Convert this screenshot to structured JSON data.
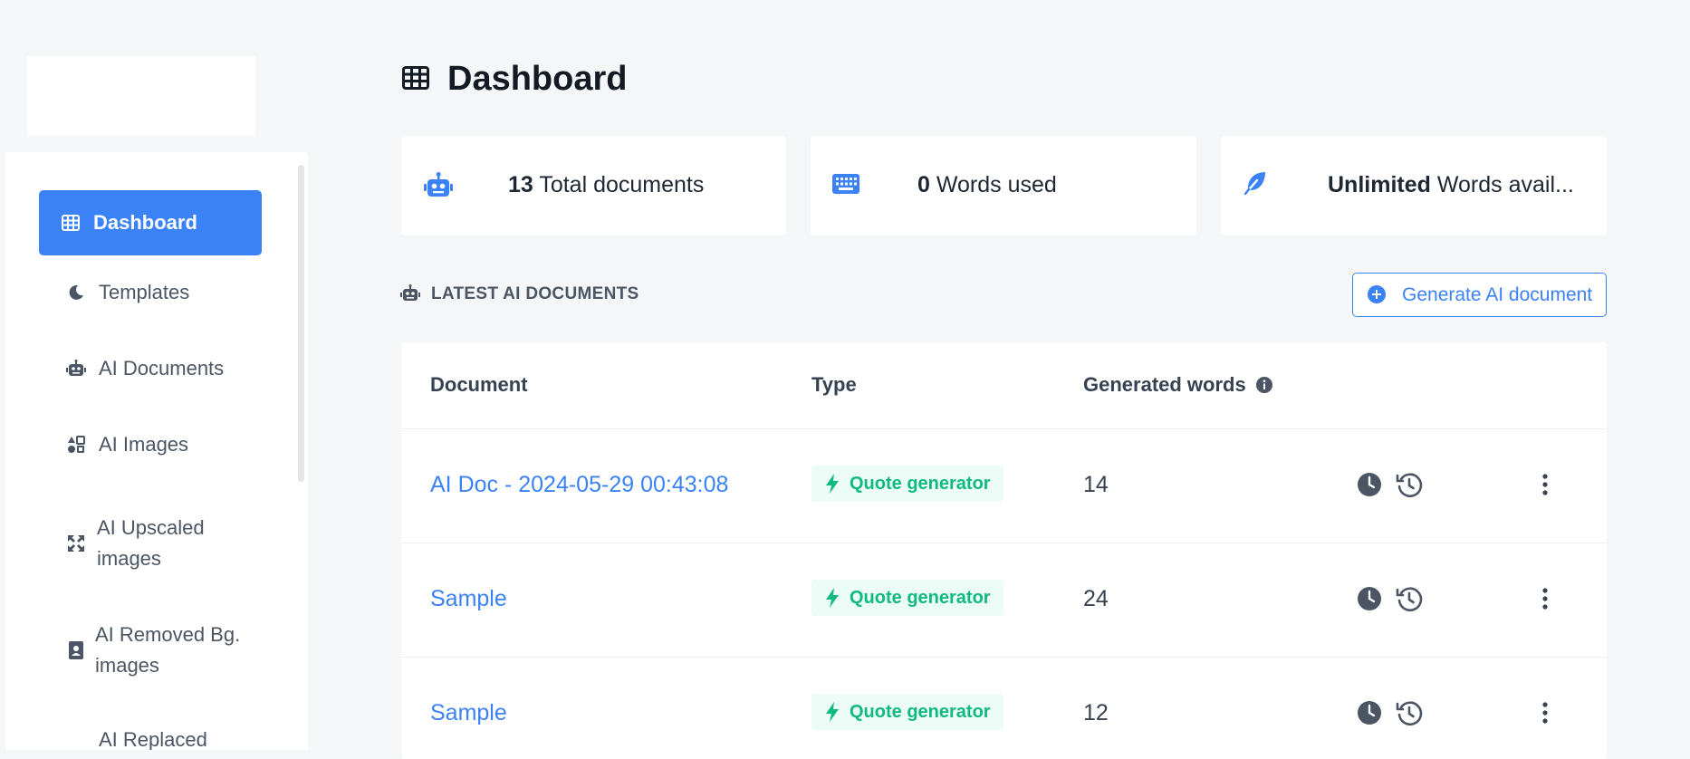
{
  "page": {
    "title": "Dashboard"
  },
  "sidebar": {
    "items": [
      {
        "label": "Dashboard",
        "icon": "table-grid-icon",
        "active": true
      },
      {
        "label": "Templates",
        "icon": "moon-icon"
      },
      {
        "label": "AI Documents",
        "icon": "robot-icon"
      },
      {
        "label": "AI Images",
        "icon": "image-shapes-icon"
      },
      {
        "label": "AI Upscaled images",
        "icon": "expand-icon"
      },
      {
        "label": "AI Removed Bg. images",
        "icon": "portrait-icon"
      },
      {
        "label": "AI Replaced",
        "icon": "replace-icon"
      }
    ]
  },
  "stats": [
    {
      "value": "13",
      "label": "Total documents",
      "icon": "robot-icon"
    },
    {
      "value": "0",
      "label": "Words used",
      "icon": "keyboard-icon"
    },
    {
      "value": "Unlimited",
      "label": "Words avail...",
      "icon": "feather-icon"
    }
  ],
  "section": {
    "title": "LATEST AI DOCUMENTS",
    "generate_button": "Generate AI document"
  },
  "table": {
    "headers": {
      "document": "Document",
      "type": "Type",
      "words": "Generated words"
    },
    "rows": [
      {
        "document": "AI Doc - 2024-05-29 00:43:08",
        "type": "Quote generator",
        "words": "14"
      },
      {
        "document": "Sample",
        "type": "Quote generator",
        "words": "24"
      },
      {
        "document": "Sample",
        "type": "Quote generator",
        "words": "12"
      }
    ]
  },
  "colors": {
    "accent": "#3b82f6",
    "badge_text": "#10b981",
    "badge_bg": "#ecfdf7",
    "background": "#f5f6f8"
  }
}
